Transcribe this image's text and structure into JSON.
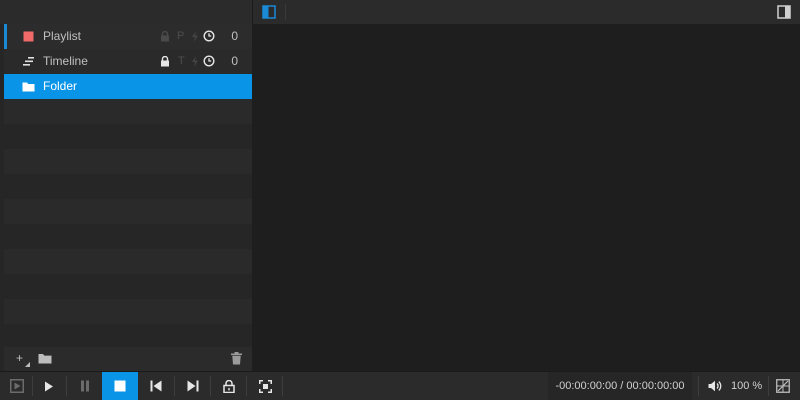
{
  "topbar": {
    "left_panel_icon": "panel-left-icon",
    "right_panel_icon": "panel-right-icon"
  },
  "sidebar": {
    "items": [
      {
        "label": "Playlist",
        "icon": "square-icon",
        "icon_color": "#f06a6a",
        "flags": [
          "lock-icon",
          "P",
          "bolt-icon",
          "clock-icon"
        ],
        "count": "0"
      },
      {
        "label": "Timeline",
        "icon": "timeline-icon",
        "flags": [
          "lock-icon",
          "T",
          "bolt-icon",
          "clock-icon"
        ],
        "count": "0"
      },
      {
        "label": "Folder",
        "icon": "folder-icon",
        "selected": true
      }
    ],
    "footer": {
      "add_label": "+",
      "folder_icon": "folder-icon",
      "delete_icon": "trash-icon"
    }
  },
  "transport": {
    "timecode": "-00:00:00:00 / 00:00:00:00",
    "volume": "100 %"
  },
  "colors": {
    "accent": "#0a94e8",
    "playlist_icon": "#f06a6a"
  }
}
